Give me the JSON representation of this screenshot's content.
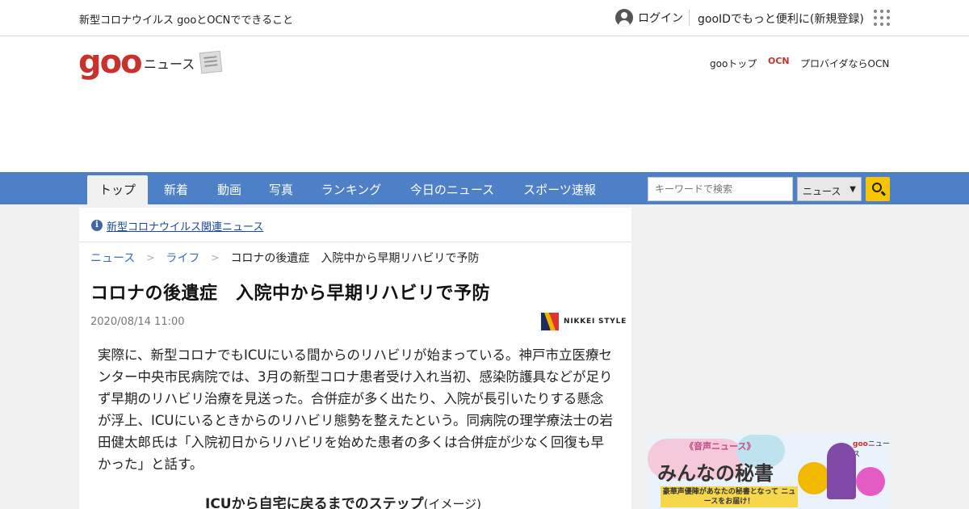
{
  "topbar": {
    "campaign": "新型コロナウイルス gooとOCNでできること",
    "login": "ログイン",
    "register": "gooIDでもっと便利に(新規登録)"
  },
  "header": {
    "logo": "goo",
    "section": "ニュース",
    "goo_top": "gooトップ",
    "ocn_logo": "OCN",
    "ocn_text": "プロバイダならOCN"
  },
  "nav": {
    "tabs": [
      "トップ",
      "新着",
      "動画",
      "写真",
      "ランキング",
      "今日のニュース",
      "スポーツ速報"
    ],
    "active_tab": "トップ",
    "search_placeholder": "キーワードで検索",
    "search_scope": "ニュース"
  },
  "article": {
    "notice": "新型コロナウイルス関連ニュース",
    "breadcrumb": [
      "ニュース",
      "ライフ",
      "コロナの後遺症　入院中から早期リハビリで予防"
    ],
    "title": "コロナの後遺症　入院中から早期リハビリで予防",
    "date": "2020/08/14 11:00",
    "source": "NIKKEI STYLE",
    "body": "実際に、新型コロナでもICUにいる間からのリハビリが始まっている。神戸市立医療センター中央市民病院では、3月の新型コロナ患者受け入れ当初、感染防護具などが足りず早期のリハビリ治療を見送った。合併症が多く出たり、入院が長引いたりする懸念が浮上、ICUにいるときからのリハビリ態勢を整えたという。同病院の理学療法士の岩田健太郎氏は「入院初日からリハビリを始めた患者の多くは合併症が少なく回復も早かった」と話す。",
    "figure_title": "ICUから自宅に戻るまでのステップ",
    "figure_subtitle": "(イメージ)"
  },
  "ad": {
    "pill": "《音声ニュース》",
    "headline": "みんなの秘書",
    "tagline": "豪華声優陣があなたの秘書となって ニュースをお届け！",
    "brand_goo": "goo",
    "brand_rest": "ニュース"
  },
  "colors": {
    "nav_bg": "#4d80c6",
    "logo_red": "#c9322c",
    "search_button": "#f7c600",
    "link_blue": "#3b6eb4"
  }
}
